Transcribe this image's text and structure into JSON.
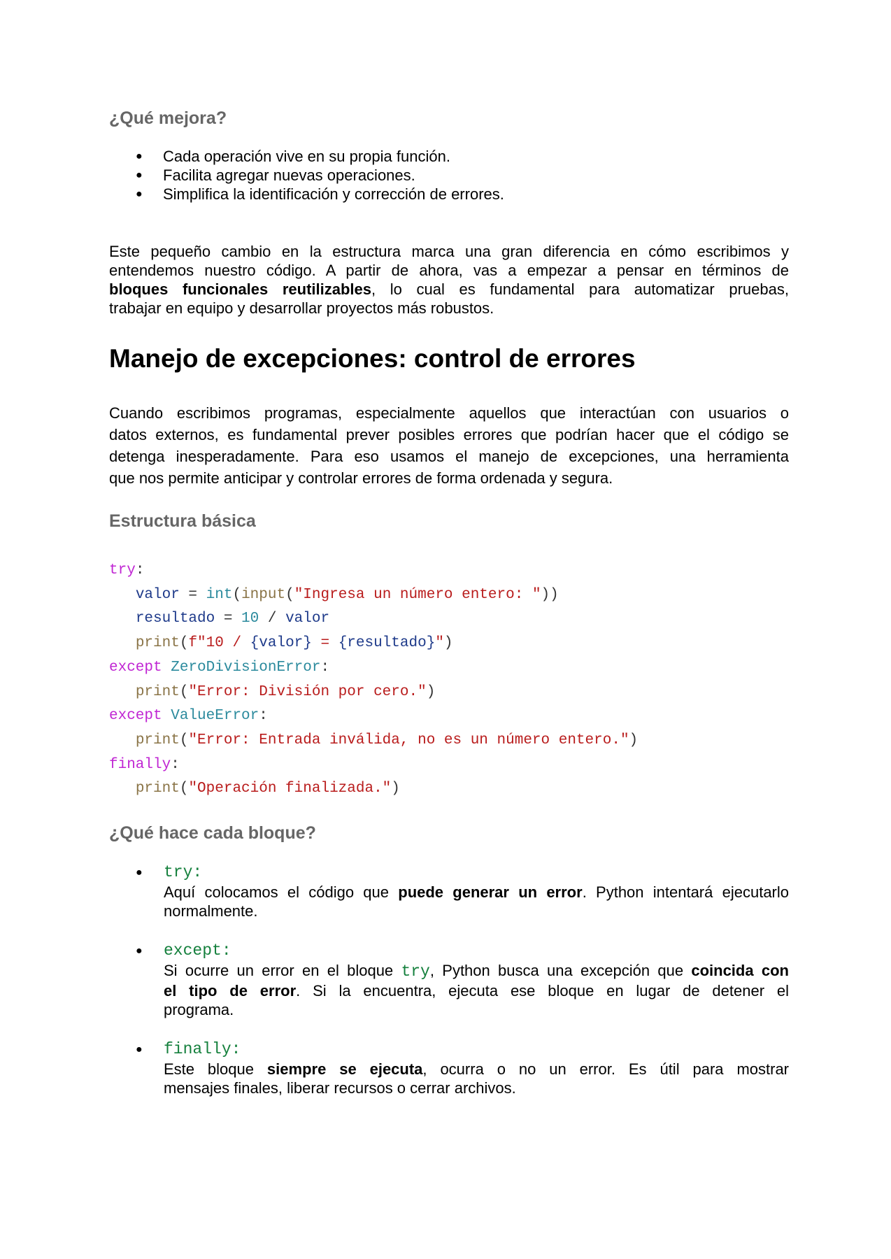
{
  "section1": {
    "heading": "¿Qué mejora?",
    "bullets": [
      "Cada operación vive en su propia función.",
      "Facilita agregar nuevas operaciones.",
      "Simplifica la identificación y corrección de errores."
    ]
  },
  "paragraph1": {
    "line1": "Este pequeño cambio en la estructura marca una gran diferencia en cómo escribimos y",
    "line2": "entendemos nuestro código. A partir de ahora, vas a empezar a pensar en términos de",
    "line3_bold": "bloques funcionales reutilizables",
    "line3_rest": ", lo cual es fundamental para automatizar pruebas,",
    "line4": "trabajar en equipo y desarrollar proyectos más robustos."
  },
  "main_heading": "Manejo de excepciones: control de errores",
  "paragraph2": {
    "line1": "Cuando escribimos programas, especialmente aquellos que interactúan con usuarios o",
    "line2": "datos externos, es fundamental prever posibles errores que podrían hacer que el código se",
    "line3": "detenga inesperadamente. Para eso usamos el manejo de excepciones, una herramienta",
    "line4": "que nos permite anticipar y controlar errores de forma ordenada y segura."
  },
  "section2": {
    "heading": "Estructura básica"
  },
  "code": {
    "try_kw": "try",
    "valor": "valor",
    "int": "int",
    "input": "input",
    "prompt": "\"Ingresa un número entero: \"",
    "resultado": "resultado",
    "ten": "10",
    "print": "print",
    "fstring_prefix": "f\"10 / ",
    "fstring_valor": "{valor}",
    "fstring_mid": " = ",
    "fstring_res": "{resultado}",
    "fstring_end": "\"",
    "except_kw": "except",
    "zde": "ZeroDivisionError",
    "msg_zero": "\"Error: División por cero.\"",
    "ve": "ValueError",
    "msg_value": "\"Error: Entrada inválida, no es un número entero.\"",
    "finally_kw": "finally",
    "msg_final": "\"Operación finalizada.\""
  },
  "section3": {
    "heading": "¿Qué hace cada bloque?",
    "try_block": {
      "label": "try:",
      "l1_pre": " Aquí colocamos el código que ",
      "l1_bold": "puede generar un error",
      "l1_post": ". Python intentará ejecutarlo",
      "l2": "normalmente."
    },
    "except_block": {
      "label": "except:",
      "l1_pre": " Si ocurre un error en el bloque ",
      "l1_code": "try",
      "l1_mid": ", Python busca una excepción que ",
      "l1_bold": "coincida con",
      "l2_bold": "el tipo de error",
      "l2_post": ". Si la encuentra, ejecuta ese bloque en lugar de detener el",
      "l3": "programa."
    },
    "finally_block": {
      "label": "finally:",
      "l1_pre": "  Este bloque ",
      "l1_bold": "siempre se ejecuta",
      "l1_post": ", ocurra o no un error. Es útil para mostrar",
      "l2": "mensajes finales, liberar recursos o cerrar archivos."
    }
  }
}
